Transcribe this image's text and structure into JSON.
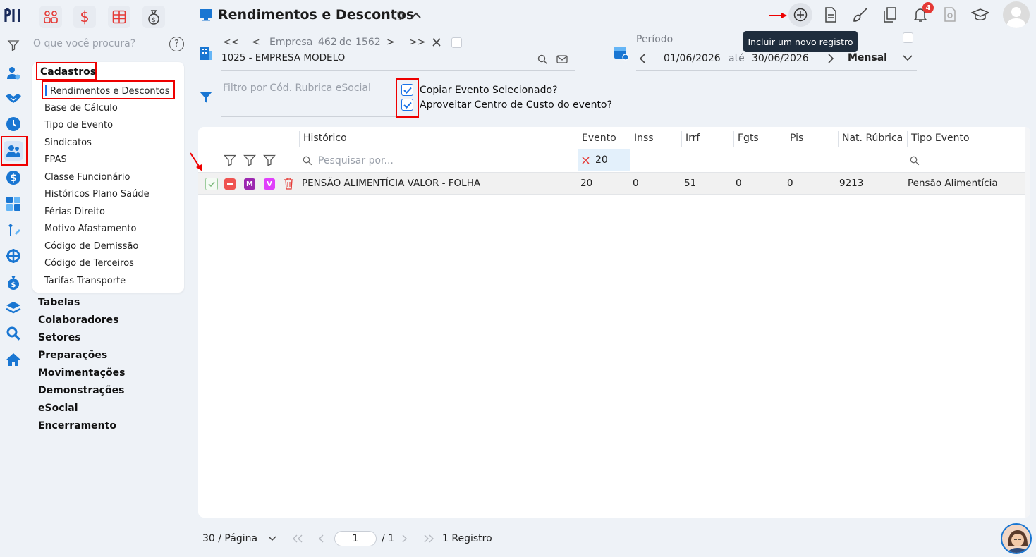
{
  "header": {
    "title": "Rendimentos e Descontos",
    "tooltip": "Incluir um novo registro",
    "notification_count": "4"
  },
  "search": {
    "placeholder": "O que você procura?"
  },
  "menu": {
    "section_title": "Cadastros",
    "items": [
      "Rendimentos e Descontos",
      "Base de Cálculo",
      "Tipo de Evento",
      "Sindicatos",
      "FPAS",
      "Classe Funcionário",
      "Históricos Plano Saúde",
      "Férias Direito",
      "Motivo Afastamento",
      "Código de Demissão",
      "Código de Terceiros",
      "Tarifas Transporte"
    ],
    "sections": [
      "Tabelas",
      "Colaboradores",
      "Setores",
      "Preparações",
      "Movimentações",
      "Demonstrações",
      "eSocial",
      "Encerramento"
    ]
  },
  "company": {
    "nav_first": "<<",
    "nav_prev": "<",
    "nav_label": "Empresa",
    "current": "462",
    "of_label": "de",
    "total": "1562",
    "nav_next": ">",
    "nav_last": ">>",
    "name": "1025 - EMPRESA MODELO"
  },
  "period": {
    "label": "Período",
    "start": "01/06/2026",
    "between": "até",
    "end": "30/06/2026",
    "mode": "Mensal"
  },
  "filter": {
    "placeholder": "Filtro por Cód. Rubrica eSocial",
    "copy_event_label": "Copiar Evento Selecionado?",
    "copy_event_checked": true,
    "cost_center_label": "Aproveitar Centro de Custo do evento?",
    "cost_center_checked": true
  },
  "table": {
    "columns": [
      "Histórico",
      "Evento",
      "Inss",
      "Irrf",
      "Fgts",
      "Pis",
      "Nat. Rúbrica",
      "Tipo Evento"
    ],
    "search_placeholder": "Pesquisar por...",
    "evento_filter": "20",
    "row_badges": [
      "M",
      "V"
    ],
    "rows": [
      {
        "historico": "PENSÃO ALIMENTÍCIA VALOR - FOLHA",
        "evento": "20",
        "inss": "0",
        "irrf": "51",
        "fgts": "0",
        "pis": "0",
        "nat": "9213",
        "tipo": "Pensão Alimentícia"
      }
    ]
  },
  "footer": {
    "page_size": "30 / Página",
    "page": "1",
    "page_total": "/ 1",
    "records": "1 Registro"
  },
  "colors": {
    "accent": "#1a73e8",
    "highlight": "#e00000",
    "tooltip_bg": "#1f2d3d"
  }
}
